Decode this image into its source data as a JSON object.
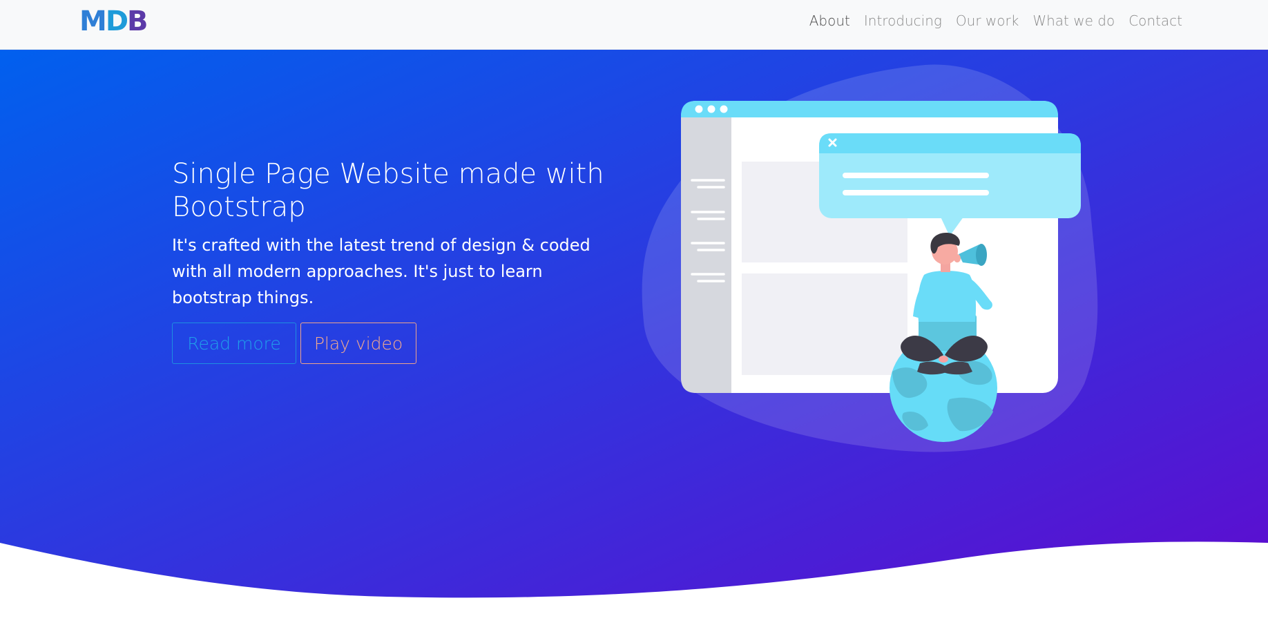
{
  "brand": {
    "logo_letters": [
      "M",
      "D",
      "B"
    ]
  },
  "nav": {
    "items": [
      {
        "label": "About",
        "active": true
      },
      {
        "label": "Introducing",
        "active": false
      },
      {
        "label": "Our work",
        "active": false
      },
      {
        "label": "What we do",
        "active": false
      },
      {
        "label": "Contact",
        "active": false
      }
    ]
  },
  "hero": {
    "title": "Single Page Website made with Bootstrap",
    "subtitle": "It's crafted with the latest trend of design & coded with all modern approaches. It's just to learn bootstrap things.",
    "read_more_label": "Read more",
    "play_video_label": "Play video",
    "gradient_start": "#0160ee",
    "gradient_end": "#5e0ccf"
  },
  "colors": {
    "navbar_bg": "#f8f9fa",
    "nav_active": "#4a4a4a",
    "nav_inactive": "#8a8a8a",
    "read_more": "#20a1ea",
    "play_video": "#f6ab8c",
    "illustration_accent": "#6adcf8"
  },
  "icons": {
    "close_icon": "×",
    "megaphone_icon": "megaphone",
    "globe_icon": "globe"
  }
}
